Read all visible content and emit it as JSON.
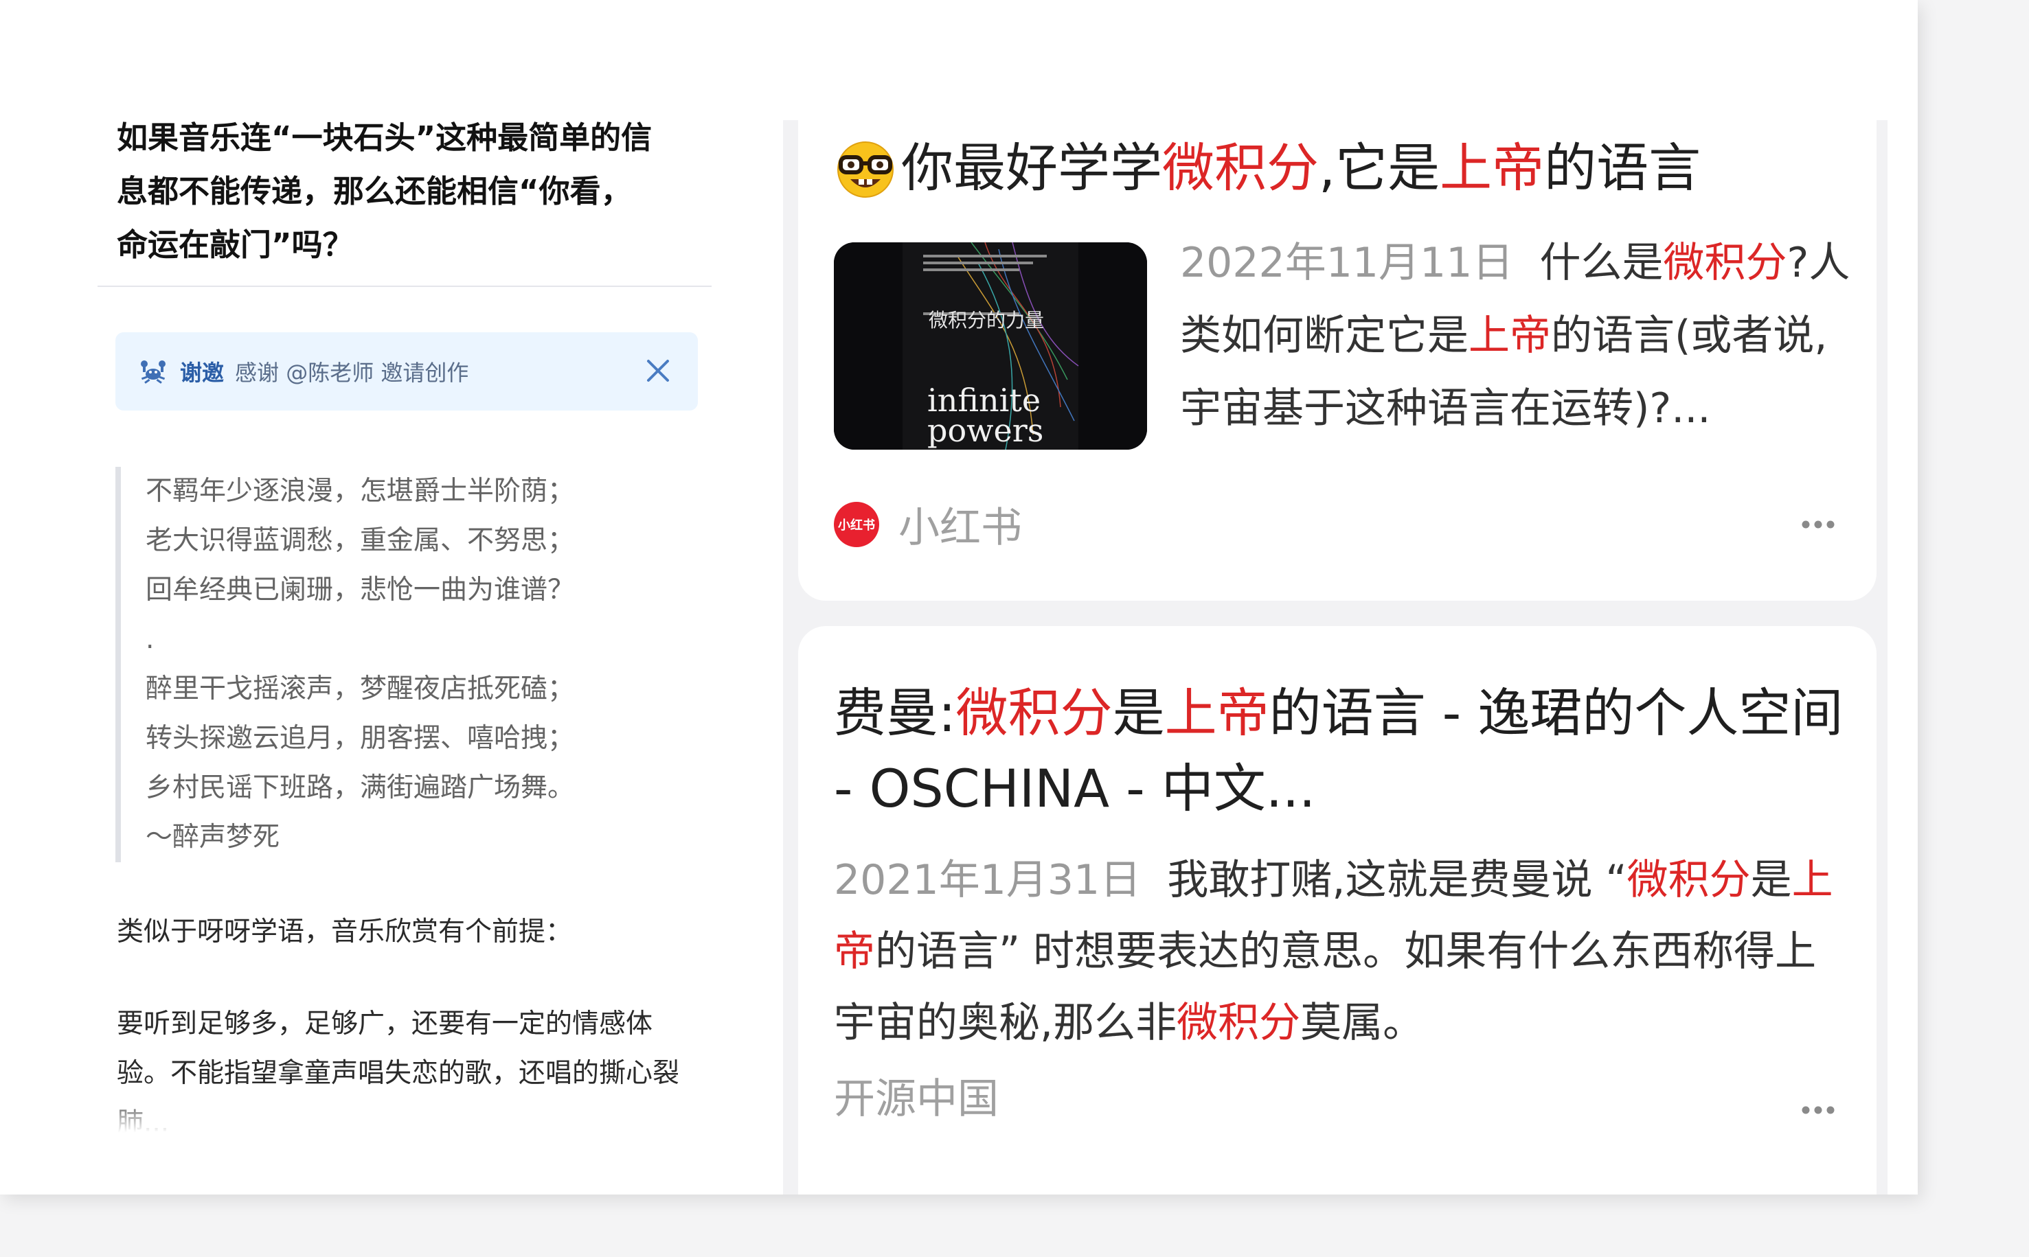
{
  "zhihu": {
    "question_lines": [
      "如果音乐连“一块石头”这种最简单的信",
      "息都不能传递，那么还能相信“你看，",
      "命运在敲门”吗？"
    ],
    "invite": {
      "label": "谢邀",
      "text": "感谢 @陈老师 邀请创作"
    },
    "poem": [
      "不羁年少逐浪漫，怎堪爵士半阶荫；",
      "老大识得蓝调愁，重金属、不努思；",
      "回牟经典已阑珊，悲怆一曲为谁谱？",
      ".",
      "醉里干戈摇滚声，梦醒夜店抵死磕；",
      "转头探邀云追月，朋客摆、嘻哈拽；",
      "乡村民谣下班路，满街遍踏广场舞。",
      "～醉声梦死"
    ],
    "para1": "类似于呀呀学语，音乐欣赏有个前提：",
    "para2": "要听到足够多，足够广，还要有一定的情感体验。不能指望拿童声唱失恋的歌，还唱的撕心裂肺..."
  },
  "results": [
    {
      "title_parts": [
        "你最好学学",
        "微积分",
        ",它是",
        "上帝",
        "的语言"
      ],
      "date": "2022年11月11日",
      "snippet_parts": [
        "什么是",
        "微积分",
        "?人类如何断定它是",
        "上帝",
        "的语言(或者说,宇宙基于这种语言在运转)?..."
      ],
      "source": "小红书",
      "source_logo_text": "小红书",
      "thumb": {
        "title": "微积分的力量",
        "subtitle": "infinite powers",
        "bg": "#0b0b0d"
      }
    },
    {
      "title_parts": [
        "费曼:",
        "微积分",
        "是",
        "上帝",
        "的语言 - 逸珺的个人空间 - OSCHINA - 中文..."
      ],
      "date": "2021年1月31日",
      "snippet_parts": [
        "我敢打赌,这就是费曼说 “",
        "微积分",
        "是",
        "上帝",
        "的语言” 时想要表达的意思。如果有什么东西称得上宇宙的奥秘,那么非",
        "微积分",
        "莫属。"
      ],
      "source": "开源中国"
    }
  ],
  "colors": {
    "highlight": "#dc2626",
    "invite_bg": "#ebf5ff",
    "invite_label": "#2b5ea7",
    "xhs_red": "#e8212f"
  }
}
